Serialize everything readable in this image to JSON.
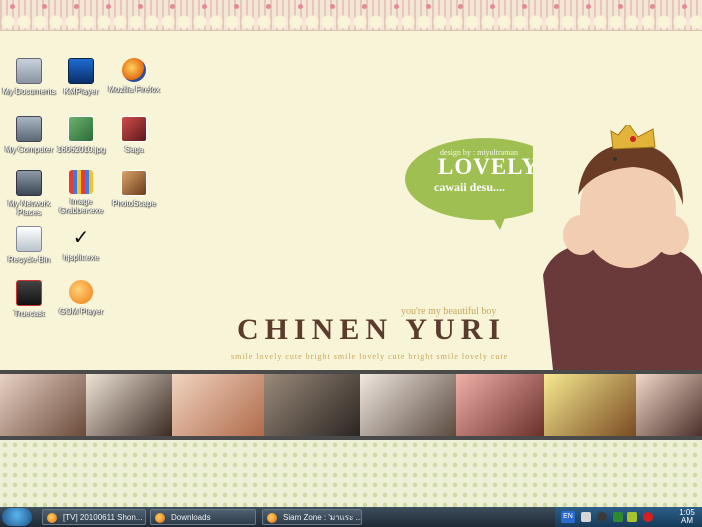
{
  "desktop": {
    "icons": [
      {
        "label": "My Documents",
        "icon": "documents-icon"
      },
      {
        "label": "KMPlayer",
        "icon": "media-player-icon"
      },
      {
        "label": "Mozilla Firefox",
        "icon": "firefox-icon"
      },
      {
        "label": "My Computer",
        "icon": "computer-icon"
      },
      {
        "label": "16062010.jpg",
        "icon": "image-file-icon"
      },
      {
        "label": "Saga",
        "icon": "image-file-icon"
      },
      {
        "label": "My Network Places",
        "icon": "network-icon"
      },
      {
        "label": "Image Grabber.exe",
        "icon": "grabber-icon"
      },
      {
        "label": "PhotoScape",
        "icon": "photoscape-icon"
      },
      {
        "label": "Recycle Bin",
        "icon": "recycle-bin-icon"
      },
      {
        "label": "hjsplit.exe",
        "icon": "checkmark-icon"
      },
      {
        "label": "Truecast",
        "icon": "truecast-icon"
      },
      {
        "label": "GOM Player",
        "icon": "gom-player-icon"
      }
    ]
  },
  "wallpaper": {
    "bubble_design": "design by : miyultraman",
    "bubble_lovely": "LOVELY",
    "bubble_cawaii": "cawaii desu....",
    "tagline": "you're my beautiful boy",
    "title": "CHINEN YURI",
    "subtitle": "smile lovely cute bright smile lovely cute bright smile lovely cute"
  },
  "taskbar": {
    "windows": [
      {
        "label": "[TV] 20100611 Shon...",
        "icon": "firefox-icon"
      },
      {
        "label": "Downloads",
        "icon": "firefox-icon"
      },
      {
        "label": "Siam Zone : 'มาแระ ...",
        "icon": "firefox-icon"
      }
    ],
    "tray": {
      "language": "EN",
      "clock_time": "05",
      "clock_period": "AM",
      "clock_hour": "1"
    }
  },
  "colors": {
    "title": "#5a3b2c",
    "bubble": "#9fbf52",
    "accent_gold": "#c5a75a"
  }
}
